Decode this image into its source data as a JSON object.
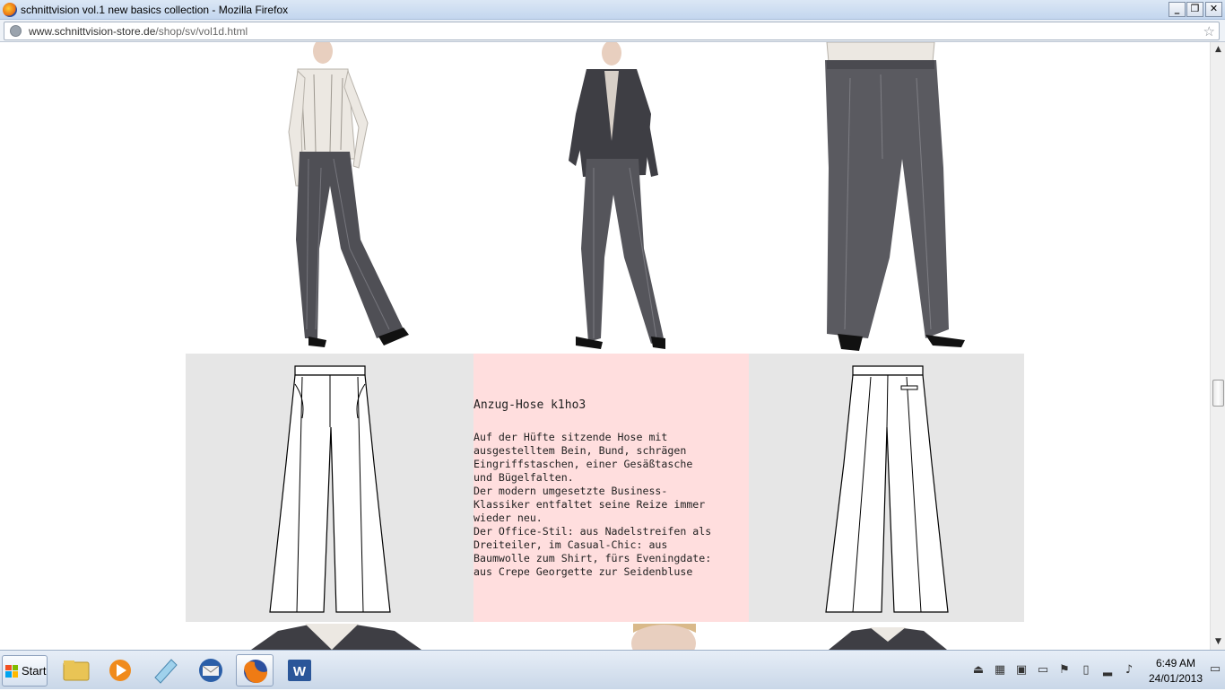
{
  "window": {
    "title": "schnittvision vol.1 new basics collection - Mozilla Firefox"
  },
  "address": {
    "domain": "www.schnittvision-store.de",
    "path": "/shop/sv/vol1d.html"
  },
  "product": {
    "title": "Anzug-Hose k1ho3",
    "description": "Auf der Hüfte sitzende Hose mit\nausgestelltem Bein, Bund, schrägen\nEingriffstaschen, einer Gesäßtasche\nund Bügelfalten.\nDer modern umgesetzte Business-\nKlassiker entfaltet seine Reize immer\nwieder neu.\nDer Office-Stil: aus Nadelstreifen als\nDreiteiler, im Casual-Chic: aus\nBaumwolle zum Shirt, fürs Eveningdate:\naus Crepe Georgette zur Seidenbluse"
  },
  "taskbar": {
    "start_label": "Start",
    "time": "6:49 AM",
    "date": "24/01/2013"
  },
  "colors": {
    "pink_panel": "#ffdede",
    "grey_panel": "#e6e6e6",
    "trousers": "#4f4f55"
  }
}
